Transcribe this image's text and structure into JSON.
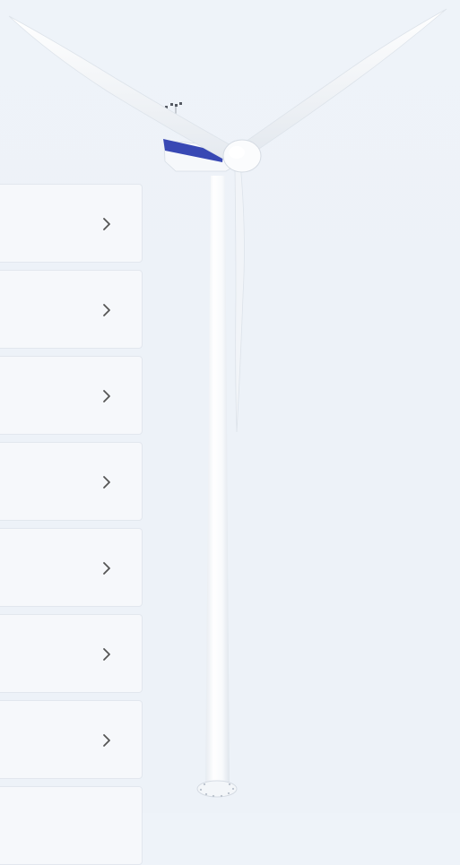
{
  "cards": [
    {
      "label": "",
      "icon": "chevron-right-icon"
    },
    {
      "label": "",
      "icon": "chevron-right-icon"
    },
    {
      "label": "",
      "icon": "chevron-right-icon"
    },
    {
      "label": "",
      "icon": "chevron-right-icon"
    },
    {
      "label": "",
      "icon": "chevron-right-icon"
    },
    {
      "label": "",
      "icon": "chevron-right-icon"
    },
    {
      "label": "",
      "icon": "chevron-right-icon"
    },
    {
      "label": "",
      "icon": "chevron-right-icon"
    }
  ],
  "illustration": {
    "subject": "wind-turbine",
    "accent_color": "#3848b4",
    "body_color": "#ffffff"
  },
  "colors": {
    "background": "#edf2f8",
    "card_background": "#f6f8fb",
    "card_border": "#e2e7ee",
    "chevron": "#555555"
  }
}
